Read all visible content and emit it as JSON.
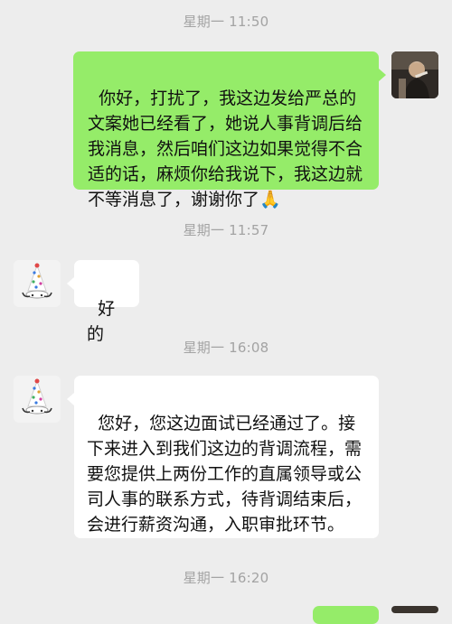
{
  "chat": {
    "timestamps": [
      "星期一 11:50",
      "星期一 11:57",
      "星期一 16:08",
      "星期一 16:20"
    ],
    "messages": [
      {
        "sender": "me",
        "text": "你好，打扰了，我这边发给严总的文案她已经看了，她说人事背调后给我消息，然后咱们这边如果觉得不合适的话，麻烦你给我说下，我这边就不等消息了，谢谢你了",
        "emoji": "🙏"
      },
      {
        "sender": "other",
        "text": "好的"
      },
      {
        "sender": "other",
        "text": "您好，您这边面试已经通过了。接下来进入到我们这边的背调流程，需要您提供上两份工作的直属领导或公司人事的联系方式，待背调结束后，会进行薪资沟通，入职审批环节。"
      }
    ]
  },
  "colors": {
    "background": "#ededed",
    "my_bubble": "#95ec69",
    "their_bubble": "#ffffff",
    "timestamp": "#a3a3a3"
  },
  "icons": {
    "my_avatar": "person-photo-avatar",
    "their_avatar": "party-hat-avatar",
    "emoji": "praying-hands-emoji"
  }
}
